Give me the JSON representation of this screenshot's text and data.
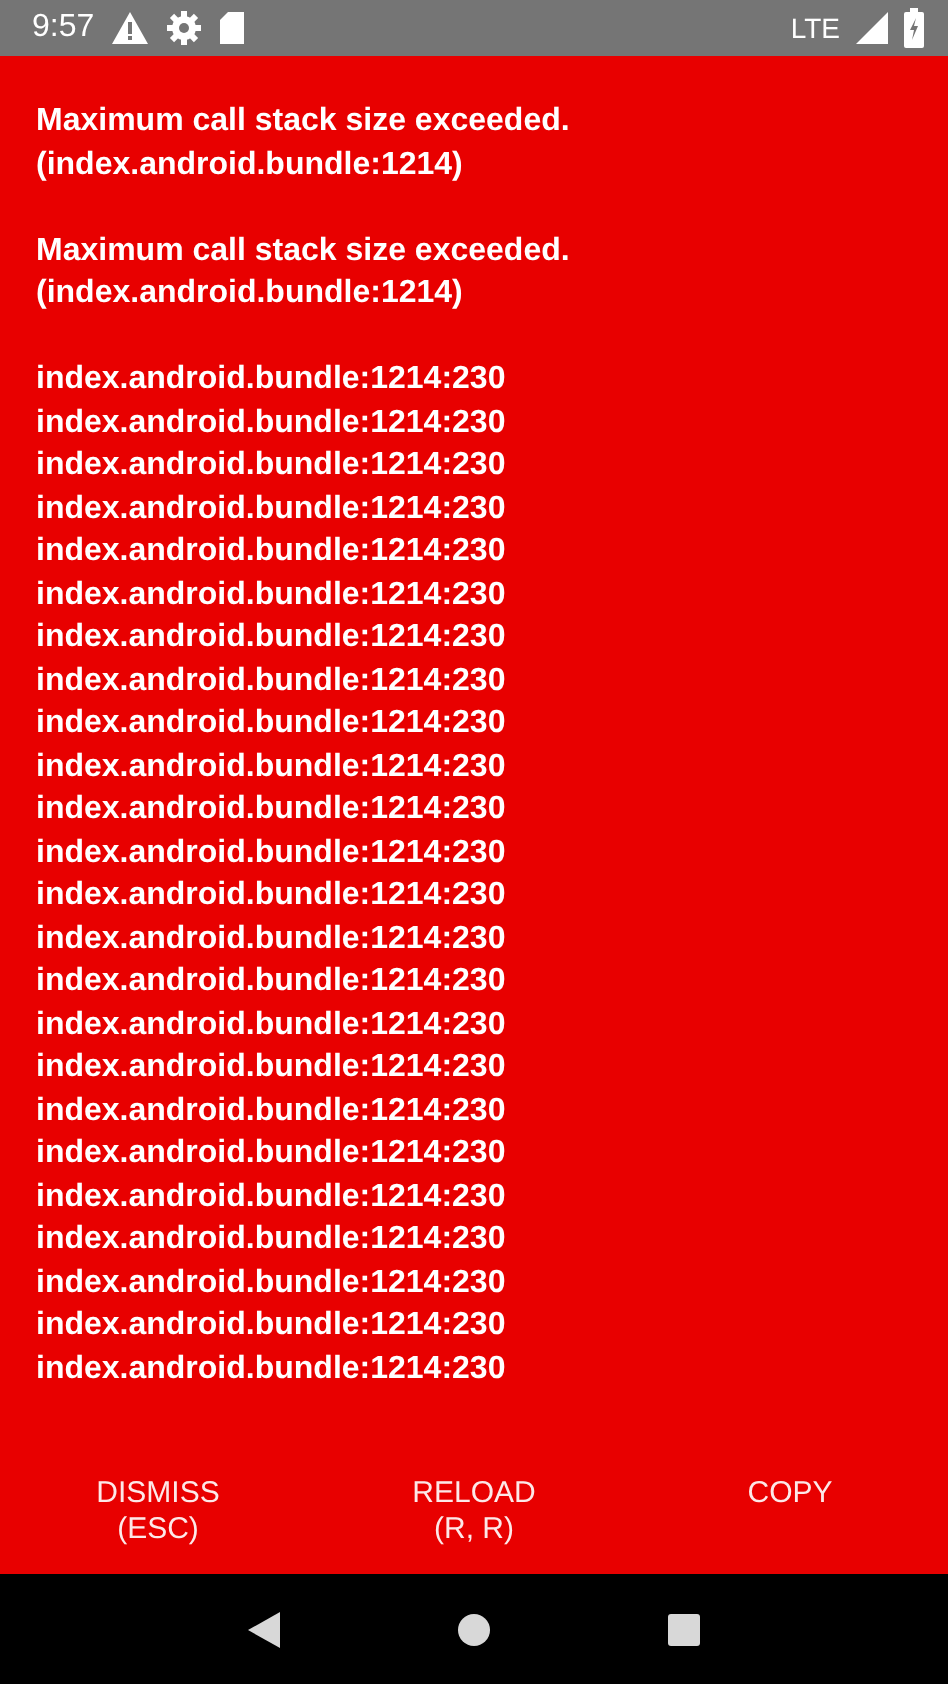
{
  "status_bar": {
    "time": "9:57",
    "network": "LTE"
  },
  "error": {
    "messages": [
      "Maximum call stack size exceeded. (index.android.bundle:1214)",
      "Maximum call stack size exceeded. (index.android.bundle:1214)"
    ],
    "stack": [
      "index.android.bundle:1214:230",
      "index.android.bundle:1214:230",
      "index.android.bundle:1214:230",
      "index.android.bundle:1214:230",
      "index.android.bundle:1214:230",
      "index.android.bundle:1214:230",
      "index.android.bundle:1214:230",
      "index.android.bundle:1214:230",
      "index.android.bundle:1214:230",
      "index.android.bundle:1214:230",
      "index.android.bundle:1214:230",
      "index.android.bundle:1214:230",
      "index.android.bundle:1214:230",
      "index.android.bundle:1214:230",
      "index.android.bundle:1214:230",
      "index.android.bundle:1214:230",
      "index.android.bundle:1214:230",
      "index.android.bundle:1214:230",
      "index.android.bundle:1214:230",
      "index.android.bundle:1214:230",
      "index.android.bundle:1214:230",
      "index.android.bundle:1214:230",
      "index.android.bundle:1214:230",
      "index.android.bundle:1214:230"
    ]
  },
  "buttons": [
    {
      "label": "DISMISS",
      "shortcut": "(ESC)"
    },
    {
      "label": "RELOAD",
      "shortcut": "(R, R)"
    },
    {
      "label": "COPY"
    }
  ]
}
